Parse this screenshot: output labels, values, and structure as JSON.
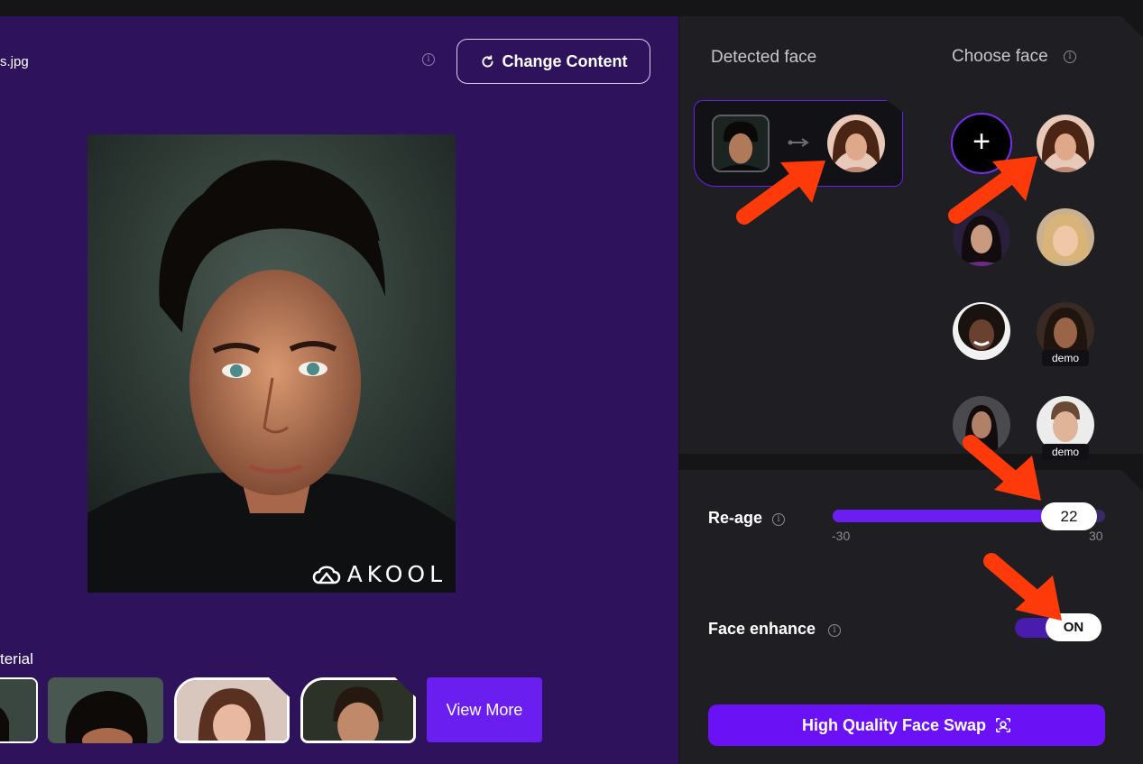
{
  "left_panel": {
    "file_name": "s.jpg",
    "change_content_label": "Change Content",
    "watermark": "AKOOL",
    "material_label": "terial",
    "view_more_label": "View More"
  },
  "right_panel": {
    "detected_face_title": "Detected face",
    "choose_face_title": "Choose face",
    "demo_badges": [
      "demo",
      "demo"
    ],
    "reage": {
      "label": "Re-age",
      "value": "22",
      "min": "-30",
      "max": "30",
      "fill_fraction": 0.87
    },
    "face_enhance": {
      "label": "Face enhance",
      "state": "ON"
    },
    "hq_button_label": "High Quality Face Swap"
  },
  "colors": {
    "accent": "#6a1ff0",
    "left_bg": "#2e135c",
    "panel_bg": "#1f1e22",
    "annotation_arrow": "#ff3a0a"
  },
  "icons": [
    "refresh-icon",
    "info-icon",
    "akool-logo-icon",
    "link-arrow-icon",
    "plus-icon",
    "face-scan-icon"
  ]
}
